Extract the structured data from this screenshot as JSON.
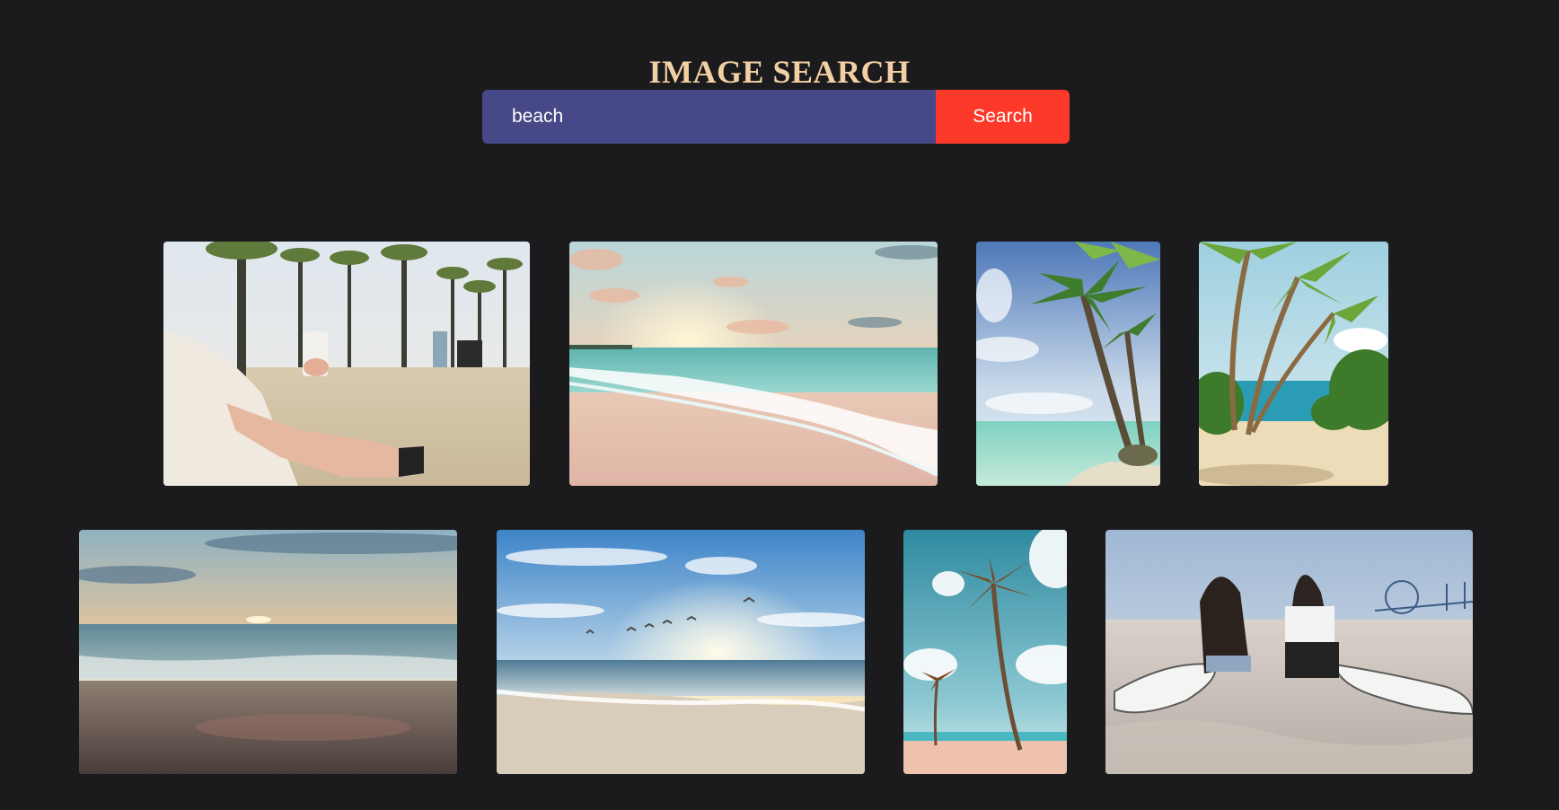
{
  "header": {
    "title": "IMAGE SEARCH"
  },
  "search": {
    "query": "beach",
    "button_label": "Search"
  },
  "results": [
    {
      "subject": "person relaxing on beach with drink carton under palm trees"
    },
    {
      "subject": "sunset over turquoise ocean wave on sand"
    },
    {
      "subject": "leaning coconut palm over turquoise shallow water"
    },
    {
      "subject": "palm trees framing tropical beach cove"
    },
    {
      "subject": "dusky sunset over gentle ocean waves"
    },
    {
      "subject": "sunrise over sea with flying seagulls"
    },
    {
      "subject": "tall palm tree against blue sky with clouds"
    },
    {
      "subject": "two women sitting on sand with surfboards near pier"
    }
  ],
  "colors": {
    "background": "#1b1a1c",
    "title": "#f2d0a4",
    "search_input": "#474887",
    "search_button": "#fd3a2a"
  }
}
